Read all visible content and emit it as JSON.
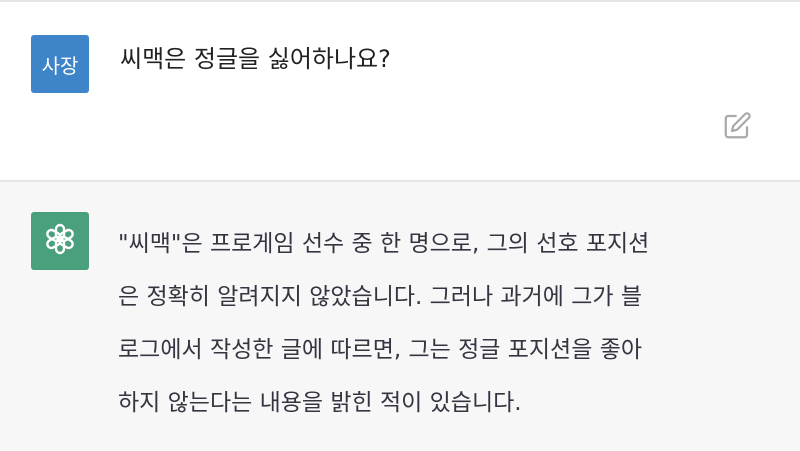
{
  "colors": {
    "user_avatar_bg": "#3d84c8",
    "assistant_avatar_bg": "#4aa07c",
    "assistant_block_bg": "#f7f7f8",
    "icon_color": "#aaaaaa"
  },
  "user_message": {
    "avatar_label": "사장",
    "text": "씨맥은 정글을 싫어하나요?",
    "edit_icon": "edit-icon"
  },
  "assistant_message": {
    "avatar_icon": "openai-logo-icon",
    "lines": [
      "\"씨맥\"은 프로게임 선수 중 한 명으로, 그의 선호 포지션",
      "은 정확히 알려지지 않았습니다. 그러나 과거에 그가 블",
      "로그에서 작성한 글에 따르면, 그는 정글 포지션을 좋아",
      "하지 않는다는 내용을 밝힌 적이 있습니다."
    ]
  }
}
